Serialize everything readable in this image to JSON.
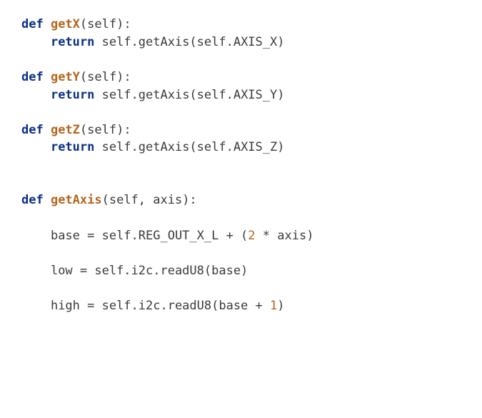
{
  "code": {
    "lines": [
      {
        "indent": 0,
        "tokens": [
          {
            "t": "kw",
            "v": "def "
          },
          {
            "t": "fn",
            "v": "getX"
          },
          {
            "t": "pl",
            "v": "(self):"
          }
        ]
      },
      {
        "indent": 1,
        "tokens": [
          {
            "t": "kw",
            "v": "return"
          },
          {
            "t": "pl",
            "v": " self.getAxis(self.AXIS_X)"
          }
        ]
      },
      {
        "indent": 0,
        "tokens": []
      },
      {
        "indent": 0,
        "tokens": [
          {
            "t": "kw",
            "v": "def "
          },
          {
            "t": "fn",
            "v": "getY"
          },
          {
            "t": "pl",
            "v": "(self):"
          }
        ]
      },
      {
        "indent": 1,
        "tokens": [
          {
            "t": "kw",
            "v": "return"
          },
          {
            "t": "pl",
            "v": " self.getAxis(self.AXIS_Y)"
          }
        ]
      },
      {
        "indent": 0,
        "tokens": []
      },
      {
        "indent": 0,
        "tokens": [
          {
            "t": "kw",
            "v": "def "
          },
          {
            "t": "fn",
            "v": "getZ"
          },
          {
            "t": "pl",
            "v": "(self):"
          }
        ]
      },
      {
        "indent": 1,
        "tokens": [
          {
            "t": "kw",
            "v": "return"
          },
          {
            "t": "pl",
            "v": " self.getAxis(self.AXIS_Z)"
          }
        ]
      },
      {
        "indent": 0,
        "tokens": []
      },
      {
        "indent": 0,
        "tokens": []
      },
      {
        "indent": 0,
        "tokens": [
          {
            "t": "kw",
            "v": "def "
          },
          {
            "t": "fn",
            "v": "getAxis"
          },
          {
            "t": "pl",
            "v": "(self, axis):"
          }
        ]
      },
      {
        "indent": 0,
        "tokens": []
      },
      {
        "indent": 1,
        "tokens": [
          {
            "t": "pl",
            "v": "base = self.REG_OUT_X_L + ("
          },
          {
            "t": "num",
            "v": "2"
          },
          {
            "t": "pl",
            "v": " * axis)"
          }
        ]
      },
      {
        "indent": 0,
        "tokens": []
      },
      {
        "indent": 1,
        "tokens": [
          {
            "t": "pl",
            "v": "low = self.i2c.readU8(base)"
          }
        ]
      },
      {
        "indent": 0,
        "tokens": []
      },
      {
        "indent": 1,
        "tokens": [
          {
            "t": "pl",
            "v": "high = self.i2c.readU8(base + "
          },
          {
            "t": "num",
            "v": "1"
          },
          {
            "t": "pl",
            "v": ")"
          }
        ]
      }
    ],
    "indent_unit": "    "
  }
}
